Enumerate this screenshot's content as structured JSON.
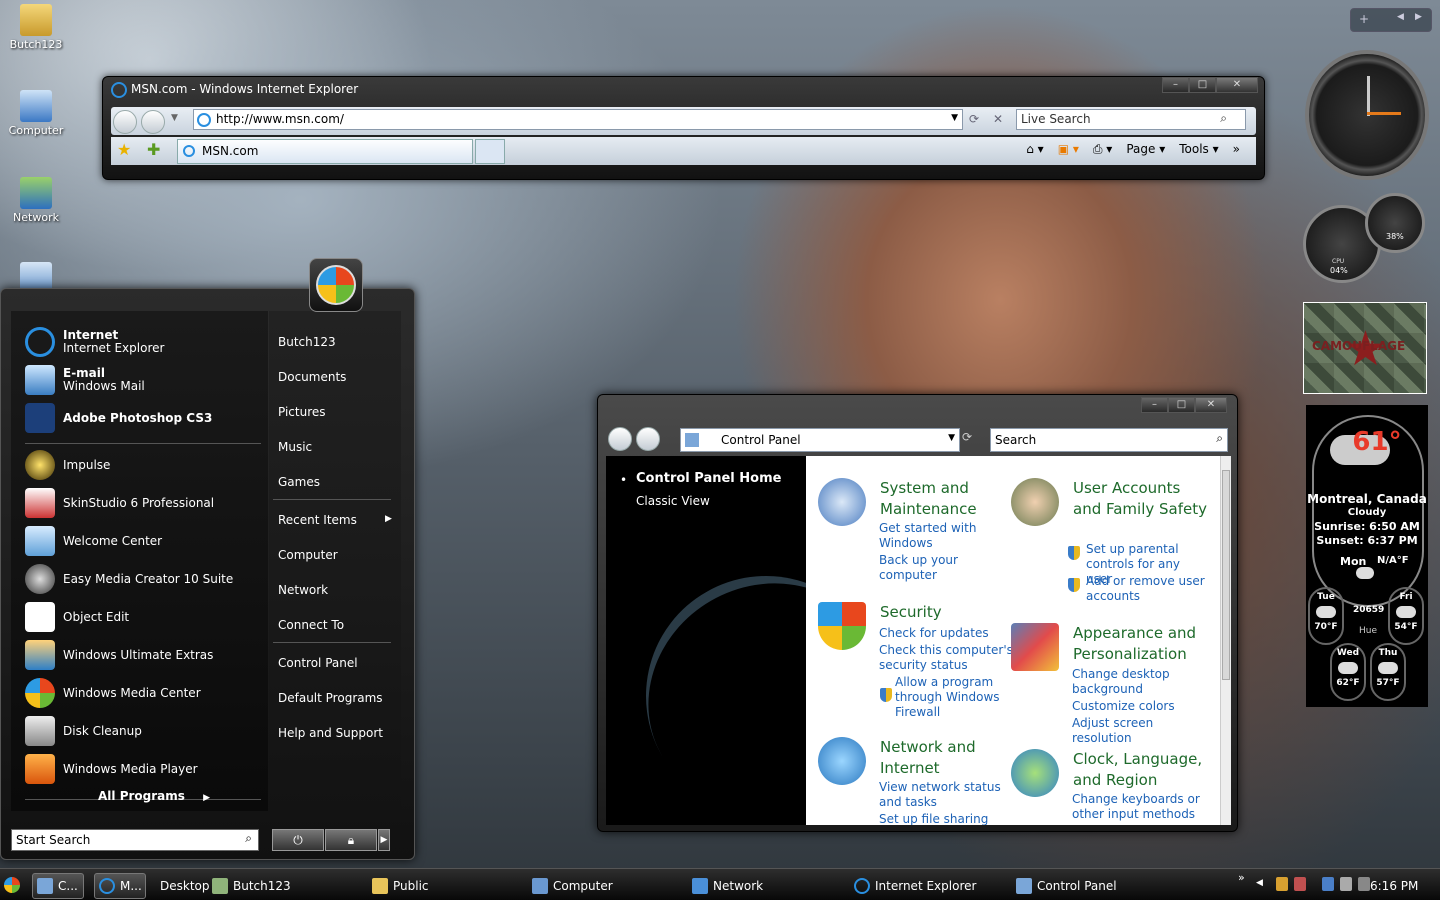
{
  "desktop": {
    "icons": [
      {
        "label": "Butch123"
      },
      {
        "label": "Computer"
      },
      {
        "label": "Network"
      }
    ]
  },
  "ie": {
    "title": "MSN.com - Windows Internet Explorer",
    "url": "http://www.msn.com/",
    "search_placeholder": "Live Search",
    "tab_label": "MSN.com",
    "toolbar": {
      "page": "Page",
      "tools": "Tools"
    }
  },
  "control_panel": {
    "address": "Control Panel",
    "search_placeholder": "Search",
    "home": "Control Panel Home",
    "classic_view": "Classic View",
    "categories": [
      {
        "title": "System and Maintenance",
        "links": [
          "Get started with Windows",
          "Back up your computer"
        ]
      },
      {
        "title": "User Accounts and Family Safety",
        "links": [
          "Set up parental controls for any user",
          "Add or remove user accounts"
        ]
      },
      {
        "title": "Security",
        "links": [
          "Check for updates",
          "Check this computer's security status",
          "Allow a program through Windows Firewall"
        ]
      },
      {
        "title": "Appearance and Personalization",
        "links": [
          "Change desktop background",
          "Customize colors",
          "Adjust screen resolution"
        ]
      },
      {
        "title": "Network and Internet",
        "links": [
          "View network status and tasks",
          "Set up file sharing"
        ]
      },
      {
        "title": "Clock, Language, and Region",
        "links": [
          "Change keyboards or other input methods"
        ]
      }
    ]
  },
  "start_menu": {
    "pinned": [
      {
        "title": "Internet",
        "sub": "Internet Explorer"
      },
      {
        "title": "E-mail",
        "sub": "Windows Mail"
      },
      {
        "title": "Adobe Photoshop CS3",
        "sub": ""
      }
    ],
    "recent": [
      "Impulse",
      "SkinStudio 6 Professional",
      "Welcome Center",
      "Easy Media Creator 10 Suite",
      "Object Edit",
      "Windows Ultimate Extras",
      "Windows Media Center",
      "Disk Cleanup",
      "Windows Media Player"
    ],
    "all_programs": "All Programs",
    "search_placeholder": "Start Search",
    "right": [
      "Butch123",
      "Documents",
      "Pictures",
      "Music",
      "Games",
      "Recent Items",
      "Computer",
      "Network",
      "Connect To",
      "Control Panel",
      "Default Programs",
      "Help and Support"
    ]
  },
  "gadgets": {
    "weather": {
      "temp": "61°",
      "city": "Montreal, Canada",
      "condition": "Cloudy",
      "sunrise": "Sunrise: 6:50 AM",
      "sunset": "Sunset: 6:37 PM",
      "today": "Mon",
      "today_temp": "N/A°F",
      "code": "20659",
      "hue": "Hue",
      "forecast": [
        {
          "day": "Tue",
          "temp": "70°F"
        },
        {
          "day": "Fri",
          "temp": "54°F"
        },
        {
          "day": "Wed",
          "temp": "62°F"
        },
        {
          "day": "Thu",
          "temp": "57°F"
        }
      ]
    },
    "cpu": {
      "label": "CPU",
      "value": "04%"
    },
    "mem": {
      "value": "38%"
    },
    "camo_label": "CAMOUFLAGE"
  },
  "taskbar": {
    "items": [
      {
        "label": "C..."
      },
      {
        "label": "M..."
      },
      {
        "label": "Desktop"
      },
      {
        "label": "Butch123"
      },
      {
        "label": "Public"
      },
      {
        "label": "Computer"
      },
      {
        "label": "Network"
      },
      {
        "label": "Internet Explorer"
      },
      {
        "label": "Control Panel"
      }
    ],
    "time": "6:16 PM"
  }
}
